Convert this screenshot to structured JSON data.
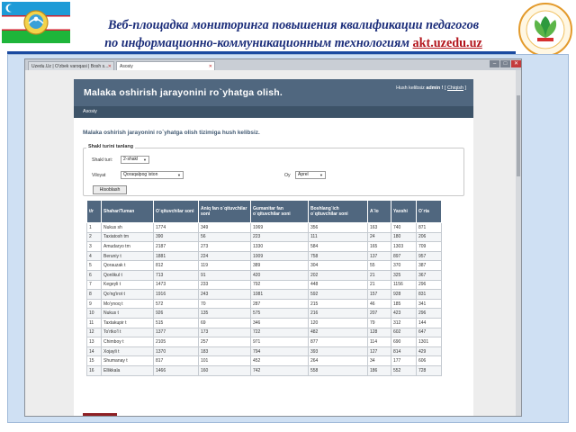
{
  "slide": {
    "title_line1": "Веб-площадка мониторинга повышения квалификации педагогов",
    "title_line2": "по информационно-коммуникационным технологиям",
    "title_link": "akt.uzedu.uz",
    "colors": {
      "title": "#1b2d7a",
      "link": "#b3151d",
      "rule": "#1a4aa0"
    }
  },
  "browser": {
    "tabs": [
      {
        "label": "Uzedu.Uz | O'zbek varoqasi | Bosh s...",
        "active": false
      },
      {
        "label": "Asosiy",
        "active": true
      }
    ]
  },
  "site": {
    "title": "Malaka oshirish jarayonini ro`yhatga olish.",
    "user_greeting": "Hush kelibsiz",
    "user_name": "admin !",
    "logout_label": "Chiqish",
    "nav_home": "Asosiy",
    "welcome": "Malaka oshirish jarayonini ro`yhatga olish tizimiga hush kelibsiz.",
    "colors": {
      "header": "#50677f",
      "nav": "#3d5368",
      "table_head": "#50677f"
    }
  },
  "form": {
    "legend": "Shakl turini tanlang",
    "shakl_label": "Shakl turi:",
    "shakl_value": "2-shakl",
    "viloyat_label": "Viloyat",
    "viloyat_value": "Qoraqalpog`iston",
    "oy_label": "Oy",
    "oy_value": "Aprel",
    "button_label": "Hisoblash"
  },
  "table": {
    "headers": [
      "t/r",
      "Shahar/Tuman",
      "O`qituvchilar soni",
      "Aniq fan o`qituvchilar soni",
      "Gumanitar fan o`qituvchilar soni",
      "Boshlang`ich o`qituvchilar soni",
      "A`lo",
      "Yaxshi",
      "O`rta"
    ],
    "rows": [
      [
        "1",
        "Nukus sh",
        "1774",
        "349",
        "1069",
        "356",
        "163",
        "740",
        "871"
      ],
      [
        "2",
        "Taxiatosh tm",
        "390",
        "56",
        "223",
        "111",
        "24",
        "180",
        "206"
      ],
      [
        "3",
        "Amudaryo tm",
        "2187",
        "273",
        "1330",
        "584",
        "165",
        "1303",
        "709"
      ],
      [
        "4",
        "Beruniy t",
        "1881",
        "224",
        "1009",
        "758",
        "137",
        "897",
        "957"
      ],
      [
        "5",
        "Qorauzak t",
        "812",
        "119",
        "389",
        "304",
        "55",
        "370",
        "387"
      ],
      [
        "6",
        "Qonlikul t",
        "713",
        "91",
        "420",
        "202",
        "21",
        "325",
        "367"
      ],
      [
        "7",
        "Kegeyli t",
        "1473",
        "233",
        "792",
        "448",
        "21",
        "1156",
        "296"
      ],
      [
        "8",
        "Qo'ng'irot t",
        "1916",
        "243",
        "1081",
        "592",
        "157",
        "928",
        "831"
      ],
      [
        "9",
        "Mo'ynoq t",
        "572",
        "70",
        "287",
        "215",
        "46",
        "185",
        "341"
      ],
      [
        "10",
        "Nukus t",
        "926",
        "135",
        "575",
        "216",
        "207",
        "423",
        "296"
      ],
      [
        "11",
        "Taxtakupir t",
        "515",
        "69",
        "346",
        "120",
        "79",
        "312",
        "144"
      ],
      [
        "12",
        "To'rtko'l t",
        "1377",
        "173",
        "722",
        "482",
        "128",
        "602",
        "647"
      ],
      [
        "13",
        "Chimboy t",
        "2105",
        "257",
        "971",
        "877",
        "114",
        "690",
        "1301"
      ],
      [
        "14",
        "Xojayli t",
        "1370",
        "183",
        "794",
        "393",
        "127",
        "814",
        "429"
      ],
      [
        "15",
        "Shumanay t",
        "817",
        "101",
        "452",
        "264",
        "34",
        "177",
        "606"
      ],
      [
        "16",
        "Ellikkala",
        "1466",
        "160",
        "742",
        "558",
        "186",
        "552",
        "728"
      ]
    ]
  }
}
